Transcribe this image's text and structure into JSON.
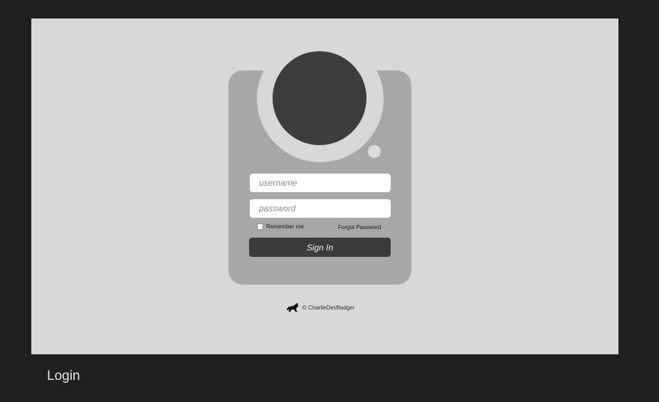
{
  "login_form": {
    "username_placeholder": "username",
    "password_placeholder": "password",
    "remember_label": "Remember me",
    "forgot_label": "Forgot Password",
    "signin_label": "Sign In"
  },
  "footer": {
    "logo_icon": "badger-icon",
    "copyright": "© CharlieDevBadger"
  },
  "page_label": "Login",
  "colors": {
    "background": "#1f1f1f",
    "canvas": "#d8d8d8",
    "card": "#a8a8a8",
    "avatar": "#3d3d3d",
    "button": "#3b3b3b"
  }
}
